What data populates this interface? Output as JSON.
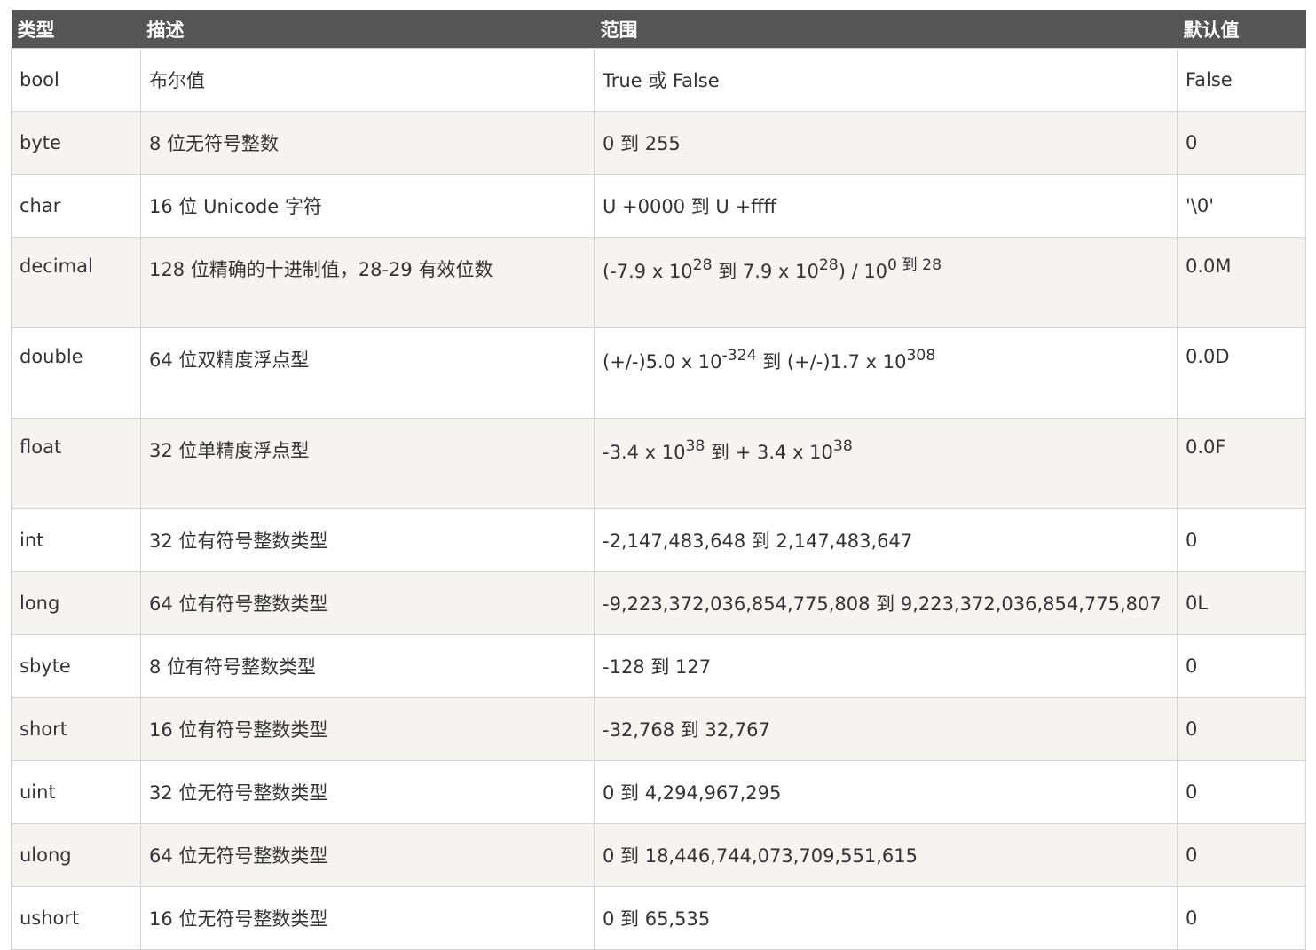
{
  "headers": {
    "type": "类型",
    "desc": "描述",
    "range": "范围",
    "default": "默认值"
  },
  "rows": [
    {
      "type": "bool",
      "desc": "布尔值",
      "range": "True 或 False",
      "default": "False"
    },
    {
      "type": "byte",
      "desc": "8 位无符号整数",
      "range": "0 到 255",
      "default": "0"
    },
    {
      "type": "char",
      "desc": "16 位 Unicode 字符",
      "range": "U +0000 到 U +ffff",
      "default": "'\\0'"
    },
    {
      "type": "decimal",
      "desc": "128 位精确的十进制值，28-29 有效位数",
      "range_parts": {
        "p1": "(-7.9 x 10",
        "e1": "28",
        "p2": " 到 7.9 x 10",
        "e2": "28",
        "p3": ") / 10",
        "e3": "0 到 28"
      },
      "default": "0.0M"
    },
    {
      "type": "double",
      "desc": "64 位双精度浮点型",
      "range_parts": {
        "p1": "(+/-)5.0 x 10",
        "e1": "-324",
        "p2": " 到 (+/-)1.7 x 10",
        "e2": "308"
      },
      "default": "0.0D"
    },
    {
      "type": "float",
      "desc": "32 位单精度浮点型",
      "range_parts": {
        "p1": "-3.4 x 10",
        "e1": "38",
        "p2": " 到 + 3.4 x 10",
        "e2": "38"
      },
      "default": "0.0F"
    },
    {
      "type": "int",
      "desc": "32 位有符号整数类型",
      "range": "-2,147,483,648 到 2,147,483,647",
      "default": "0"
    },
    {
      "type": "long",
      "desc": "64 位有符号整数类型",
      "range": "-9,223,372,036,854,775,808 到 9,223,372,036,854,775,807",
      "default": "0L"
    },
    {
      "type": "sbyte",
      "desc": "8 位有符号整数类型",
      "range": "-128 到 127",
      "default": "0"
    },
    {
      "type": "short",
      "desc": "16 位有符号整数类型",
      "range": "-32,768 到 32,767",
      "default": "0"
    },
    {
      "type": "uint",
      "desc": "32 位无符号整数类型",
      "range": "0 到 4,294,967,295",
      "default": "0"
    },
    {
      "type": "ulong",
      "desc": "64 位无符号整数类型",
      "range": "0 到 18,446,744,073,709,551,615",
      "default": "0"
    },
    {
      "type": "ushort",
      "desc": "16 位无符号整数类型",
      "range": "0 到 65,535",
      "default": "0"
    }
  ]
}
